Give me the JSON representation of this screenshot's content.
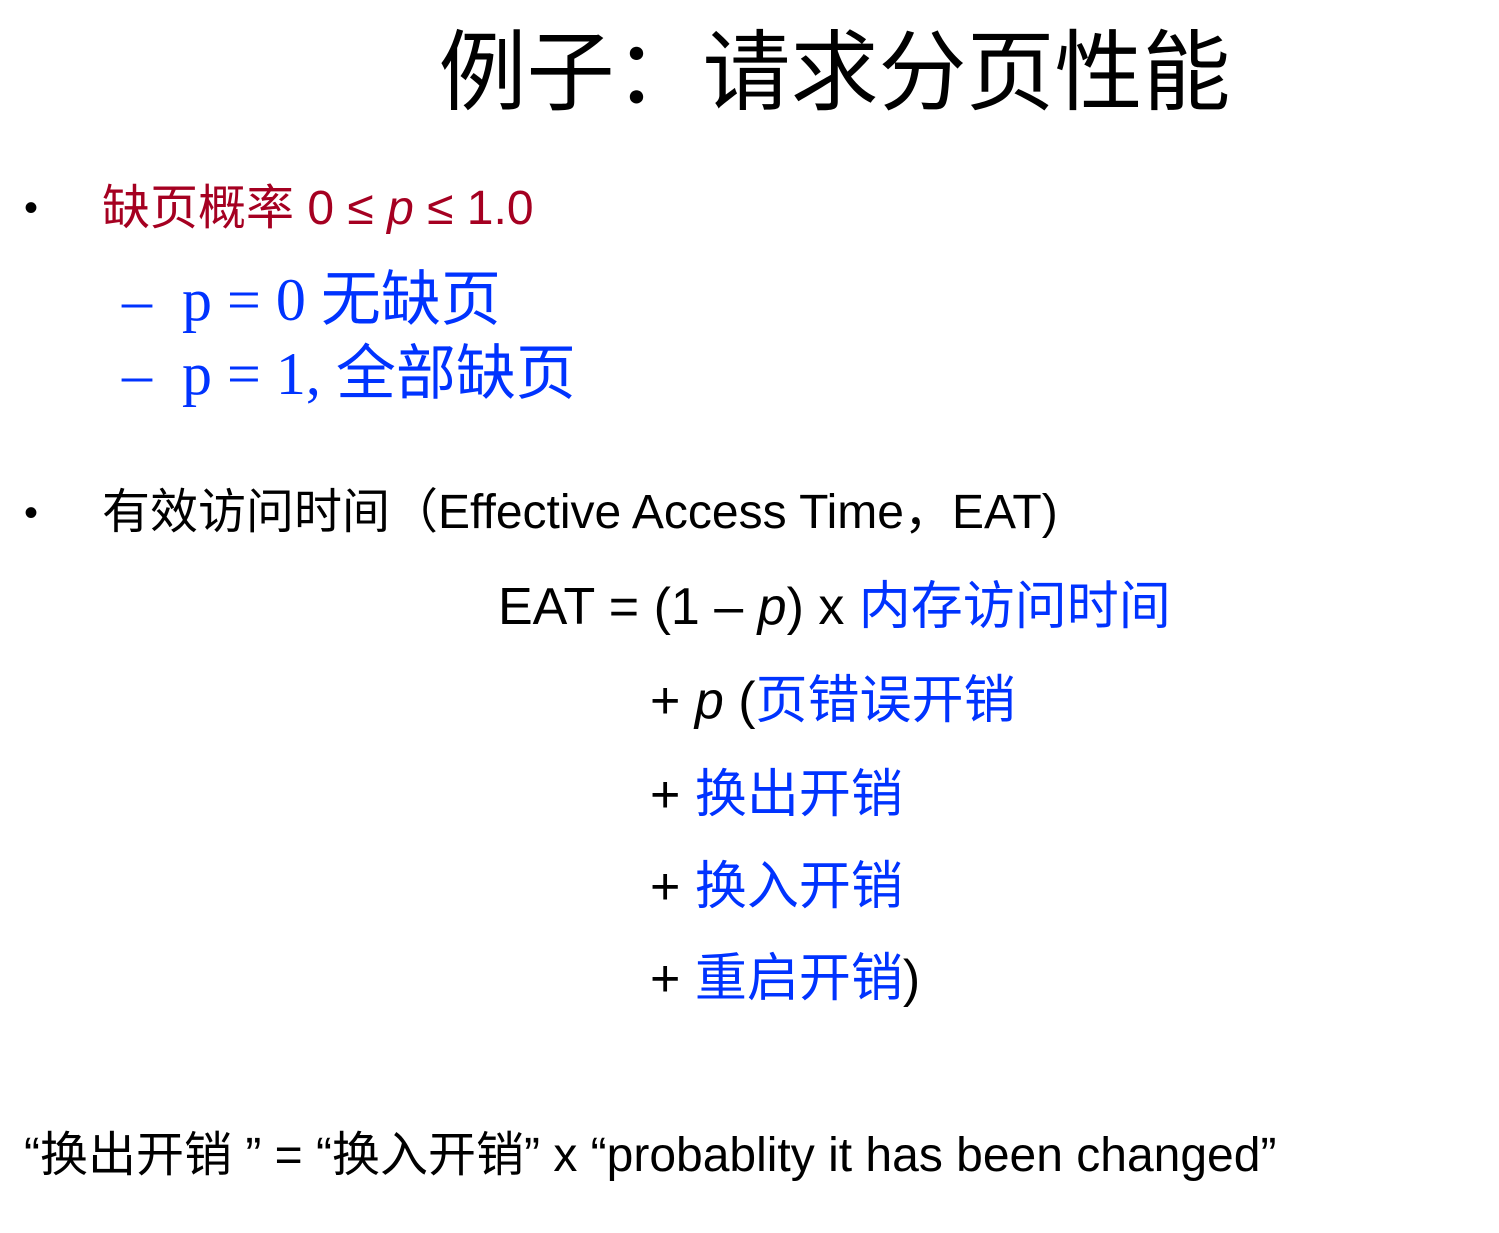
{
  "title": "例子：请求分页性能",
  "bullet_glyph": "•",
  "colors": {
    "dark_red": "#a50021",
    "blue": "#0033ff",
    "black": "#000000"
  },
  "item1": {
    "prefix": "缺页概率 0 ≤ ",
    "var": "p",
    "suffix": " ≤ 1.0",
    "subs": [
      {
        "dash": "–",
        "text": "p = 0 无缺页"
      },
      {
        "dash": "–",
        "text": "p = 1, 全部缺页"
      }
    ]
  },
  "item2": {
    "text": "有效访问时间（Effective Access Time，EAT)"
  },
  "formula": {
    "line1": {
      "lhs": "EAT = (1 – ",
      "var": "p",
      "mid": ") x ",
      "term": "内存访问时间"
    },
    "line2": {
      "plus": "+ ",
      "var": "p",
      "open": " (",
      "term": "页错误开销"
    },
    "line3": {
      "plus": "+ ",
      "term": "换出开销"
    },
    "line4": {
      "plus": "+ ",
      "term": "换入开销"
    },
    "line5": {
      "plus": "+ ",
      "term": "重启开销",
      "close": ")"
    }
  },
  "footnote": "“换出开销 ” = “换入开销” x “probablity it has been changed”"
}
